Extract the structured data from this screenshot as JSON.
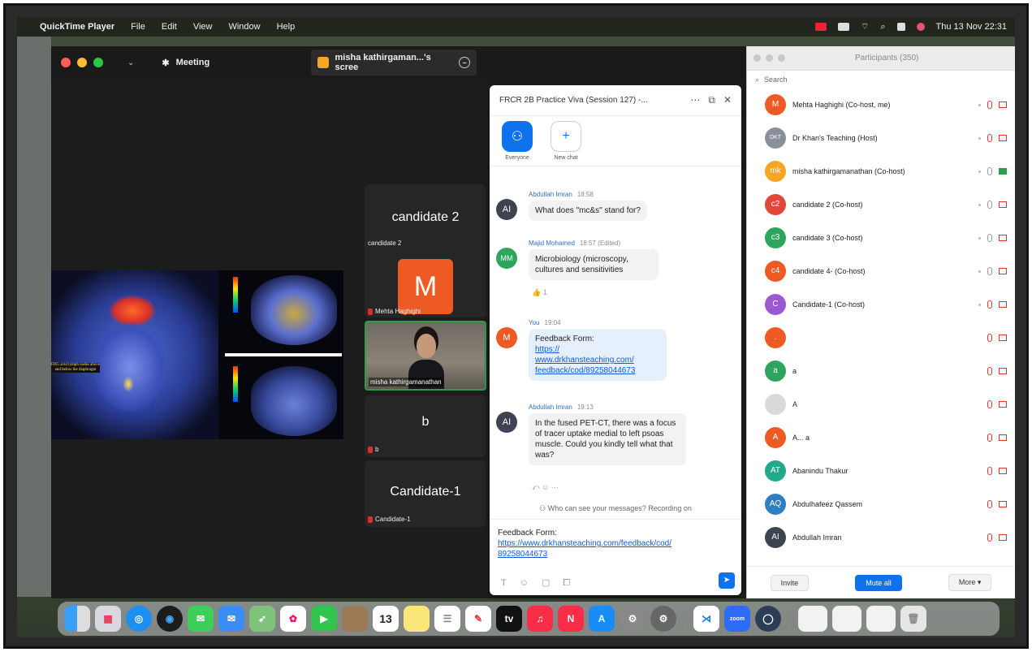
{
  "menubar": {
    "app_name": "QuickTime Player",
    "items": [
      "File",
      "Edit",
      "View",
      "Window",
      "Help"
    ],
    "clock": "Thu 13 Nov 22:31"
  },
  "zoom": {
    "meeting_label": "Meeting",
    "share_tab": "misha kathirgaman...'s scree",
    "tiles": {
      "candidate2_big": "candidate 2",
      "candidate2_small": "candidate 2",
      "mehta_initial": "M",
      "mehta_name": "Mehta Haghighi",
      "misha_name": "misha kathirgamanathan",
      "b_big": "b",
      "b_small": "b",
      "candidate1_big": "Candidate-1",
      "candidate1_small": "Candidate-1"
    },
    "scan_note": "FDG avid lymph nodes above and below the diaphragm"
  },
  "chat": {
    "title": "FRCR 2B Practice Viva (Session 127) -...",
    "tabs": [
      {
        "label": "Everyone",
        "icon": "people-icon"
      },
      {
        "label": "New chat",
        "icon": "plus-icon"
      }
    ],
    "messages": [
      {
        "sender": "Abdullah Imran",
        "time": "18:58",
        "initials": "AI",
        "text": "What does \"mc&s\" stand for?",
        "color": "#3d4350"
      },
      {
        "sender": "Majid Mohamed",
        "time": "18:57 (Edited)",
        "initials": "MM",
        "text": "Microbiology (microscopy, cultures and sensitivities",
        "color": "#2ea55f",
        "reaction": "👍 1"
      },
      {
        "sender": "You",
        "time": "19:04",
        "initials": "M",
        "line1": "Feedback Form:",
        "link1": "https://",
        "link2": "www.drkhansteaching.com/",
        "link3": "feedback/cod/89258044673",
        "color": "#ee5a24"
      },
      {
        "sender": "Abdullah Imran",
        "time": "19:13",
        "initials": "AI",
        "text": "In the fused PET-CT, there was a focus of tracer uptake medial to left psoas muscle. Could you kindly tell what that was?",
        "color": "#3d4350"
      }
    ],
    "recording_note": "Who can see your messages? Recording on",
    "compose": {
      "line1": "Feedback Form:",
      "link": "https://www.drkhansteaching.com/feedback/cod/",
      "link_end": "89258044673"
    }
  },
  "participants": {
    "title": "Participants (350)",
    "search_placeholder": "Search",
    "rows": [
      {
        "name": "Mehta Haghighi (Co-host, me)",
        "initials": "M",
        "color": "#ee5a24"
      },
      {
        "name": "Dr Khan's Teaching (Host)",
        "initials": "DKT",
        "color": "#8a8f9c"
      },
      {
        "name": "misha kathirgamanathan (Co-host)",
        "initials": "mk",
        "color": "#f5a623"
      },
      {
        "name": "candidate 2 (Co-host)",
        "initials": "c2",
        "color": "#e0473a"
      },
      {
        "name": "candidate 3 (Co-host)",
        "initials": "c3",
        "color": "#2ea55f"
      },
      {
        "name": "candidate 4- (Co-host)",
        "initials": "c4",
        "color": "#ee5a24"
      },
      {
        "name": "Candidate-1 (Co-host)",
        "initials": "C",
        "color": "#9b59d0"
      },
      {
        "name": "",
        "initials": ".",
        "color": "#ee5a24"
      },
      {
        "name": "a",
        "initials": "a",
        "color": "#2ea55f"
      },
      {
        "name": "A",
        "initials": "",
        "color": "#d9d9d9"
      },
      {
        "name": "A... a",
        "initials": "A",
        "color": "#ee5a24"
      },
      {
        "name": "Abanindu Thakur",
        "initials": "AT",
        "color": "#23a88a"
      },
      {
        "name": "Abdulhafeez Qassem",
        "initials": "AQ",
        "color": "#2d7fc1"
      },
      {
        "name": "Abdullah Imran",
        "initials": "AI",
        "color": "#3d4350"
      }
    ],
    "buttons": {
      "invite": "Invite",
      "mute_all": "Mute all",
      "more": "More ▾"
    }
  },
  "dock": {
    "calendar_day": "13"
  }
}
